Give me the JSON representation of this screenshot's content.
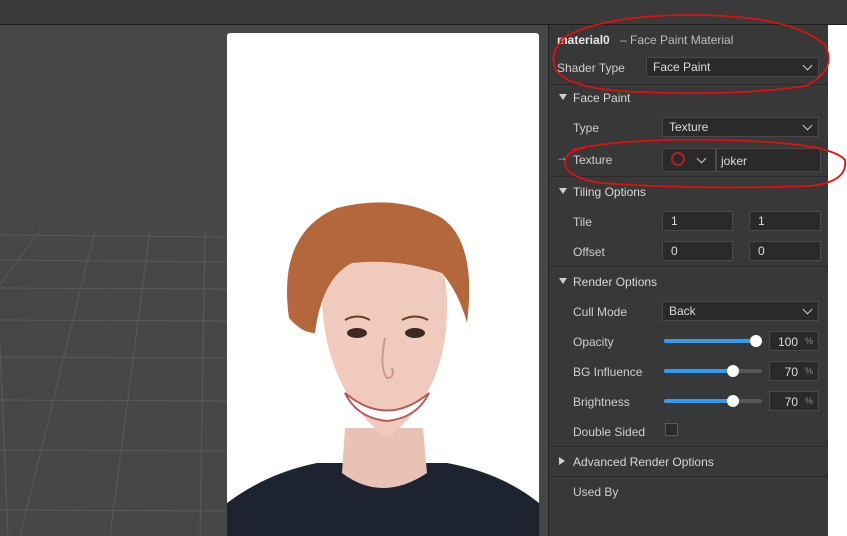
{
  "material": {
    "name": "material0",
    "description": "– Face Paint Material"
  },
  "shader": {
    "label": "Shader Type",
    "value": "Face Paint"
  },
  "face_paint": {
    "header": "Face Paint",
    "type_label": "Type",
    "type_value": "Texture",
    "texture_label": "Texture",
    "texture_value": "joker"
  },
  "tiling": {
    "header": "Tiling Options",
    "tile_label": "Tile",
    "tile_x": "1",
    "tile_y": "1",
    "offset_label": "Offset",
    "offset_x": "0",
    "offset_y": "0"
  },
  "render": {
    "header": "Render Options",
    "cull_label": "Cull Mode",
    "cull_value": "Back",
    "opacity_label": "Opacity",
    "opacity_value": "100",
    "bg_label": "BG Influence",
    "bg_value": "70",
    "brightness_label": "Brightness",
    "brightness_value": "70",
    "unit": "%",
    "double_sided_label": "Double Sided",
    "double_sided": false
  },
  "advanced": {
    "header": "Advanced Render Options"
  },
  "used_by": {
    "label": "Used By"
  },
  "colors": {
    "accent": "#2f9cf0",
    "annotation": "#e01010",
    "panel": "#383838"
  }
}
